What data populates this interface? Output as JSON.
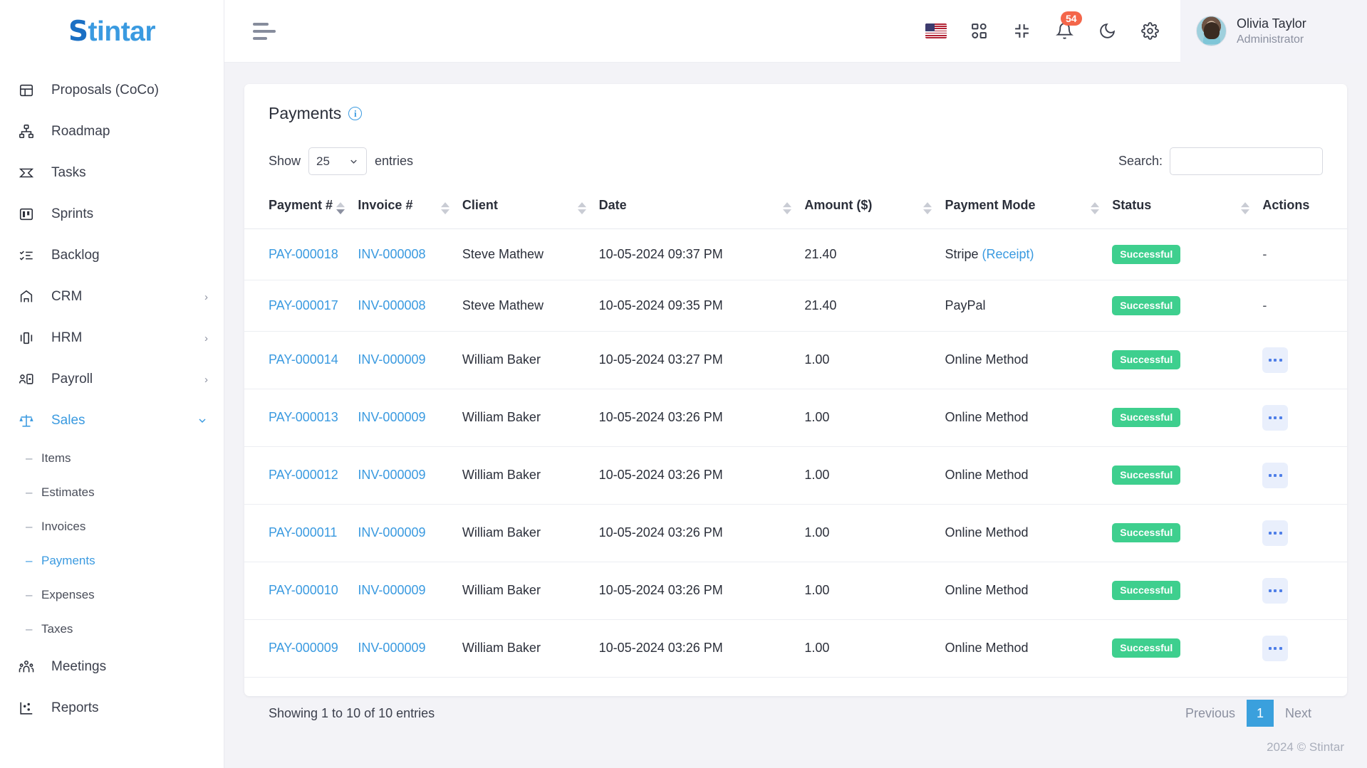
{
  "brand": {
    "name_prefix": "S",
    "name_rest": "tintar"
  },
  "sidebar": {
    "items": [
      {
        "label": "Proposals (CoCo)",
        "icon": "proposals-icon",
        "expandable": false
      },
      {
        "label": "Roadmap",
        "icon": "roadmap-icon",
        "expandable": false
      },
      {
        "label": "Tasks",
        "icon": "tasks-icon",
        "expandable": false
      },
      {
        "label": "Sprints",
        "icon": "sprints-icon",
        "expandable": false
      },
      {
        "label": "Backlog",
        "icon": "backlog-icon",
        "expandable": false
      },
      {
        "label": "CRM",
        "icon": "crm-icon",
        "expandable": true,
        "caret": "›"
      },
      {
        "label": "HRM",
        "icon": "hrm-icon",
        "expandable": true,
        "caret": "›"
      },
      {
        "label": "Payroll",
        "icon": "payroll-icon",
        "expandable": true,
        "caret": "›"
      },
      {
        "label": "Sales",
        "icon": "sales-icon",
        "expandable": true,
        "caret": "⌄",
        "active": true
      }
    ],
    "sales_subitems": [
      {
        "label": "Items",
        "dash": "–"
      },
      {
        "label": "Estimates",
        "dash": "–"
      },
      {
        "label": "Invoices",
        "dash": "–"
      },
      {
        "label": "Payments",
        "dash": "–",
        "active": true
      },
      {
        "label": "Expenses",
        "dash": "–"
      },
      {
        "label": "Taxes",
        "dash": "–"
      }
    ],
    "items_after": [
      {
        "label": "Meetings",
        "icon": "meetings-icon"
      },
      {
        "label": "Reports",
        "icon": "reports-icon"
      }
    ]
  },
  "topbar": {
    "menu_toggle": "hamburger-icon",
    "language_flag": "us-flag-icon",
    "apps_icon": "grid-apps-icon",
    "fullscreen_icon": "compress-icon",
    "notifications_icon": "bell-icon",
    "notifications_count": "54",
    "dark_mode_icon": "moon-icon",
    "settings_icon": "gear-icon",
    "user": {
      "name": "Olivia Taylor",
      "role": "Administrator"
    }
  },
  "page": {
    "title": "Payments",
    "info_glyph": "i"
  },
  "controls": {
    "show_label": "Show",
    "entries_label": "entries",
    "page_length": "25",
    "search_label": "Search:",
    "search_value": "",
    "search_placeholder": ""
  },
  "table": {
    "columns": [
      {
        "label": "Payment #",
        "sortable": true,
        "sort": "desc"
      },
      {
        "label": "Invoice #",
        "sortable": true,
        "sort": "none"
      },
      {
        "label": "Client",
        "sortable": true,
        "sort": "none"
      },
      {
        "label": "Date",
        "sortable": true,
        "sort": "none"
      },
      {
        "label": "Amount ($)",
        "sortable": true,
        "sort": "none"
      },
      {
        "label": "Payment Mode",
        "sortable": true,
        "sort": "none"
      },
      {
        "label": "Status",
        "sortable": true,
        "sort": "none"
      },
      {
        "label": "Actions",
        "sortable": false,
        "sort": "none"
      }
    ],
    "rows": [
      {
        "payment": "PAY-000018",
        "invoice": "INV-000008",
        "client": "Steve Mathew",
        "date": "10-05-2024 09:37 PM",
        "amount": "21.40",
        "mode": "Stripe",
        "mode_link": "(Receipt)",
        "status": "Successful",
        "action": "dash",
        "action_dash": "-"
      },
      {
        "payment": "PAY-000017",
        "invoice": "INV-000008",
        "client": "Steve Mathew",
        "date": "10-05-2024 09:35 PM",
        "amount": "21.40",
        "mode": "PayPal",
        "mode_link": "",
        "status": "Successful",
        "action": "dash",
        "action_dash": "-"
      },
      {
        "payment": "PAY-000014",
        "invoice": "INV-000009",
        "client": "William Baker",
        "date": "10-05-2024 03:27 PM",
        "amount": "1.00",
        "mode": "Online Method",
        "mode_link": "",
        "status": "Successful",
        "action": "menu"
      },
      {
        "payment": "PAY-000013",
        "invoice": "INV-000009",
        "client": "William Baker",
        "date": "10-05-2024 03:26 PM",
        "amount": "1.00",
        "mode": "Online Method",
        "mode_link": "",
        "status": "Successful",
        "action": "menu"
      },
      {
        "payment": "PAY-000012",
        "invoice": "INV-000009",
        "client": "William Baker",
        "date": "10-05-2024 03:26 PM",
        "amount": "1.00",
        "mode": "Online Method",
        "mode_link": "",
        "status": "Successful",
        "action": "menu"
      },
      {
        "payment": "PAY-000011",
        "invoice": "INV-000009",
        "client": "William Baker",
        "date": "10-05-2024 03:26 PM",
        "amount": "1.00",
        "mode": "Online Method",
        "mode_link": "",
        "status": "Successful",
        "action": "menu"
      },
      {
        "payment": "PAY-000010",
        "invoice": "INV-000009",
        "client": "William Baker",
        "date": "10-05-2024 03:26 PM",
        "amount": "1.00",
        "mode": "Online Method",
        "mode_link": "",
        "status": "Successful",
        "action": "menu"
      },
      {
        "payment": "PAY-000009",
        "invoice": "INV-000009",
        "client": "William Baker",
        "date": "10-05-2024 03:26 PM",
        "amount": "1.00",
        "mode": "Online Method",
        "mode_link": "",
        "status": "Successful",
        "action": "menu"
      }
    ]
  },
  "footer": {
    "entries_info": "Showing 1 to 10 of 10 entries",
    "previous": "Previous",
    "current_page": "1",
    "next": "Next",
    "copyright": "2024 © Stintar"
  },
  "colors": {
    "accent": "#3a9ae0",
    "success": "#3ecf8e",
    "notification": "#f4664a",
    "pagination_active": "#3aa0dd",
    "link": "#3a9ae0"
  }
}
